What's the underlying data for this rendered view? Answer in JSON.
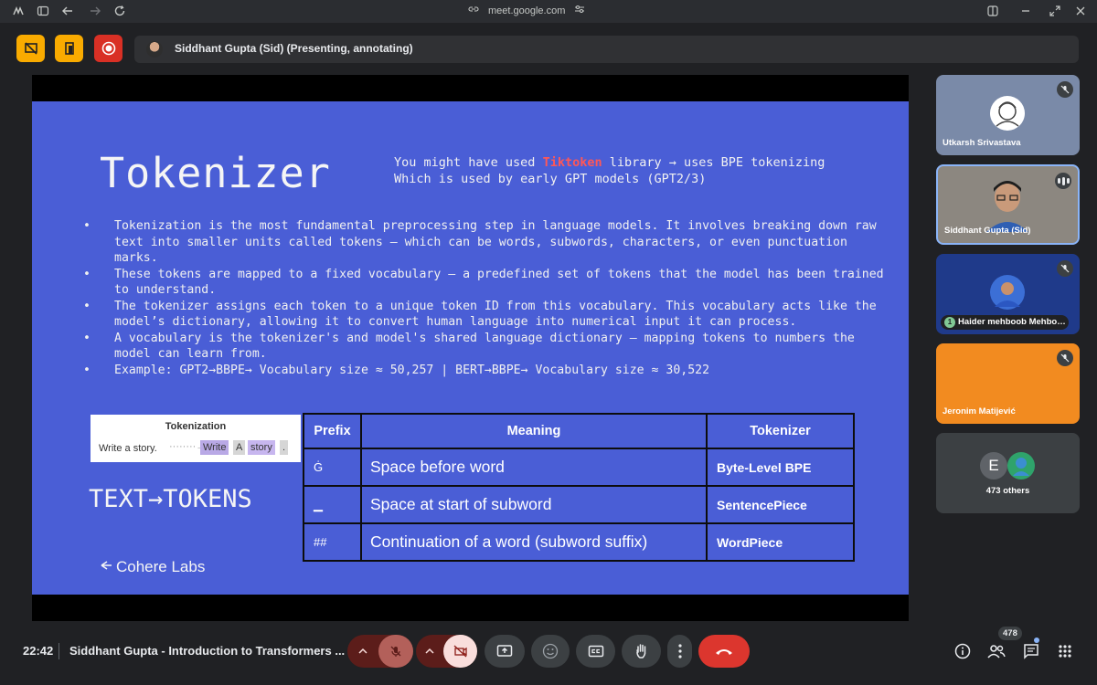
{
  "browser": {
    "url": "meet.google.com"
  },
  "presenter_bar": {
    "label": "Siddhant Gupta (Sid) (Presenting, annotating)"
  },
  "slide": {
    "title": "Tokenizer",
    "note_prefix": "You might have used ",
    "note_highlight": "Tiktoken",
    "note_rest": " library → uses BPE tokenizing\nWhich is used by early GPT models (GPT2/3)",
    "bullets": [
      "Tokenization is the most fundamental preprocessing step in language models. It involves breaking down raw text into smaller units called tokens – which can be words, subwords, characters, or even punctuation marks.",
      "These tokens are mapped to a fixed vocabulary – a predefined set of tokens that the model has been trained to understand.",
      "The tokenizer assigns each token to a unique token ID from this vocabulary. This vocabulary acts like the model’s dictionary, allowing it to convert human language into numerical input it can process.",
      "A vocabulary is the tokenizer's and model's shared language dictionary – mapping tokens to numbers the model can learn from.",
      "Example: GPT2→BBPE→ Vocabulary size ≈ 50,257 | BERT→BBPE→ Vocabulary size ≈ 30,522"
    ],
    "tokenization_image": {
      "title": "Tokenization",
      "source": "Write a story.",
      "arrow": "········→",
      "tokens": [
        "Write",
        "A",
        "story",
        "."
      ]
    },
    "text_tokens": "TEXT→TOKENS",
    "logo": "Cohere Labs",
    "table": {
      "headers": [
        "Prefix",
        "Meaning",
        "Tokenizer"
      ],
      "rows": [
        {
          "prefix": "Ġ",
          "meaning": "Space before word",
          "tokenizer": "Byte-Level BPE"
        },
        {
          "prefix": "▁",
          "meaning": "Space at start of subword",
          "tokenizer": "SentencePiece"
        },
        {
          "prefix": "##",
          "meaning": "Continuation of a word (subword suffix)",
          "tokenizer": "WordPiece"
        }
      ]
    }
  },
  "participants": [
    {
      "name": "Utkarsh Srivastava",
      "muted": true,
      "bg": "#7a8aa8"
    },
    {
      "name": "Siddhant Gupta (Sid)",
      "speaking": true,
      "bg": "#8c8780"
    },
    {
      "name": "Haider mehboob Mehbo…",
      "muted": true,
      "badge": "1",
      "bg": "#1f3a8a"
    },
    {
      "name": "Jeronim Matijević",
      "muted": true,
      "bg": "#f28b20"
    }
  ],
  "others": {
    "initial": "E",
    "label": "473 others"
  },
  "bottom": {
    "time": "22:42",
    "meeting_title": "Siddhant Gupta - Introduction to Transformers ...",
    "people_count": "478"
  },
  "icons": {
    "top_left": [
      "tab-switch-icon",
      "sidebar-icon",
      "back-icon",
      "forward-icon",
      "reload-icon"
    ],
    "controls": [
      "mic-off-icon",
      "camera-off-icon",
      "present-icon",
      "emoji-icon",
      "captions-icon",
      "raise-hand-icon",
      "more-icon",
      "hang-up-icon"
    ],
    "right": [
      "info-icon",
      "people-icon",
      "chat-icon",
      "activities-icon"
    ]
  },
  "colors": {
    "slide_bg": "#4a5ed6",
    "highlight": "#ff5757",
    "accent_yellow": "#f9ab00",
    "hangup_red": "#dc362e"
  }
}
